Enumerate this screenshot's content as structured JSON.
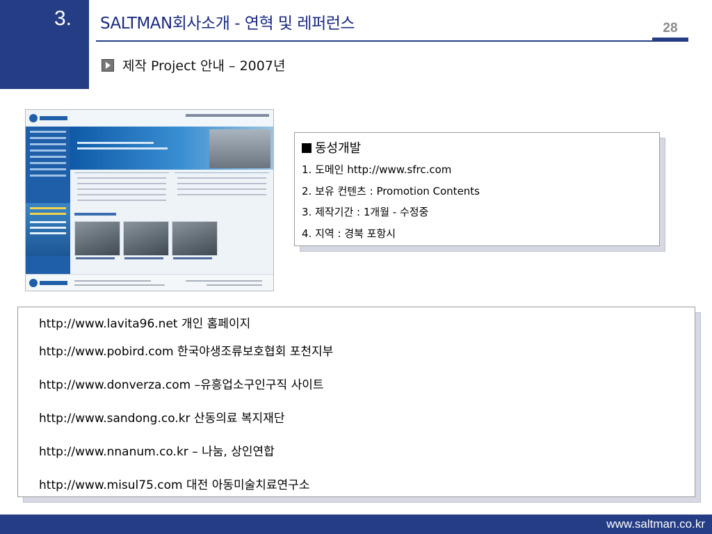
{
  "slide": {
    "section_number": "3.",
    "title": "SALTMAN회사소개 - 연혁 및 레퍼런스",
    "page_number": "28",
    "subtitle": "제작 Project 안내 – 2007년"
  },
  "info_card": {
    "title": "동성개발",
    "lines": [
      "1. 도메인 http://www.sfrc.com",
      "2. 보유 컨텐츠 : Promotion Contents",
      "3. 제작기간 : 1개월 - 수정중",
      "4. 지역 : 경북 포항시"
    ]
  },
  "links": [
    "http://www.lavita96.net 개인 홈페이지",
    "http://www.pobird.com 한국야생조류보호협회 포천지부",
    "http://www.donverza.com –유흥업소구인구직 사이트",
    "http://www.sandong.co.kr 산동의료 복지재단",
    "http://www.nnanum.co.kr – 나눔, 상인연합",
    "http://www.misul75.com 대전 아동미술치료연구소"
  ],
  "footer": {
    "url": "www.saltman.co.kr"
  },
  "colors": {
    "brand": "#253d84",
    "title": "#1a2a80",
    "page_number": "#8a8a8a"
  },
  "icons": {
    "subtitle_bullet": "play-triangle-icon",
    "info_bullet": "black-square-icon"
  }
}
